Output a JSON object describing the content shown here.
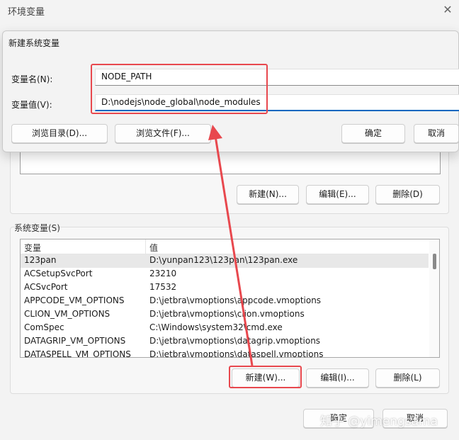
{
  "env_window": {
    "title": "环境变量",
    "close_glyph": "✕",
    "user_buttons": {
      "new": "新建(N)...",
      "edit": "编辑(E)...",
      "delete": "删除(D)"
    },
    "system_section": {
      "label": "系统变量(S)",
      "columns": [
        "变量",
        "值"
      ],
      "rows": [
        {
          "name": "123pan",
          "value": "D:\\yunpan123\\123pan\\123pan.exe"
        },
        {
          "name": "ACSetupSvcPort",
          "value": "23210"
        },
        {
          "name": "ACSvcPort",
          "value": "17532"
        },
        {
          "name": "APPCODE_VM_OPTIONS",
          "value": "D:\\jetbra\\vmoptions\\appcode.vmoptions"
        },
        {
          "name": "CLION_VM_OPTIONS",
          "value": "D:\\jetbra\\vmoptions\\clion.vmoptions"
        },
        {
          "name": "ComSpec",
          "value": "C:\\Windows\\system32\\cmd.exe"
        },
        {
          "name": "DATAGRIP_VM_OPTIONS",
          "value": "D:\\jetbra\\vmoptions\\datagrip.vmoptions"
        },
        {
          "name": "DATASPELL_VM_OPTIONS",
          "value": "D:\\jetbra\\vmoptions\\dataspell.vmoptions"
        }
      ],
      "buttons": {
        "new": "新建(W)...",
        "edit": "编辑(I)...",
        "delete": "删除(L)"
      }
    }
  },
  "new_var_dialog": {
    "title": "新建系统变量",
    "name_label": "变量名(N):",
    "name_value": "NODE_PATH",
    "value_label": "变量值(V):",
    "value_value": "D:\\nodejs\\node_global\\node_modules",
    "buttons": {
      "browse_dir": "浏览目录(D)...",
      "browse_file": "浏览文件(F)...",
      "ok": "确定",
      "cancel": "取消"
    }
  },
  "footer": {
    "ok": "确定",
    "cancel": "取消"
  },
  "watermark": "知乎 @yimengsama",
  "colors": {
    "annotation_red": "#e8484e",
    "accent_blue": "#0067c0"
  }
}
